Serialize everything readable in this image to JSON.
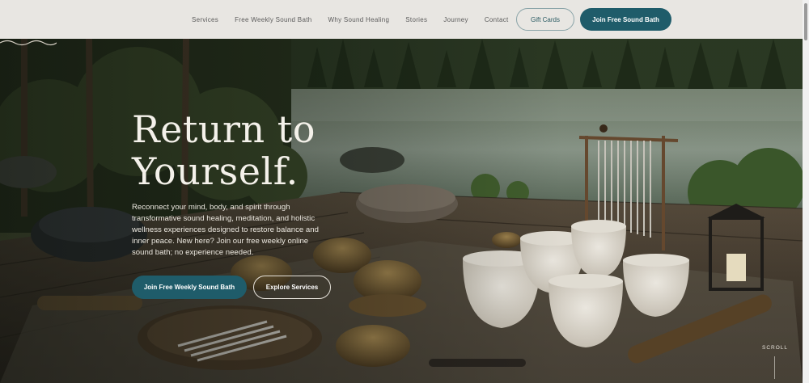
{
  "nav": {
    "items": [
      {
        "label": "Services"
      },
      {
        "label": "Free Weekly Sound Bath"
      },
      {
        "label": "Why Sound Healing"
      },
      {
        "label": "Stories"
      },
      {
        "label": "Journey"
      },
      {
        "label": "Contact"
      }
    ],
    "gift_cards_label": "Gift Cards",
    "join_label": "Join Free Sound Bath"
  },
  "hero": {
    "headline_line1": "Return to",
    "headline_line2": "Yourself.",
    "description": "Reconnect your mind, body, and spirit through transformative sound healing, meditation, and holistic wellness experiences designed to restore balance and inner peace. New here? Join our free weekly online sound bath; no experience needed.",
    "primary_button": "Join Free Weekly Sound Bath",
    "secondary_button": "Explore Services",
    "scroll_label": "SCROLL"
  },
  "colors": {
    "header_bg": "#e8e6e2",
    "accent": "#1f5c6a",
    "nav_text": "#5b5b5b",
    "headline": "#f4f1ea"
  }
}
